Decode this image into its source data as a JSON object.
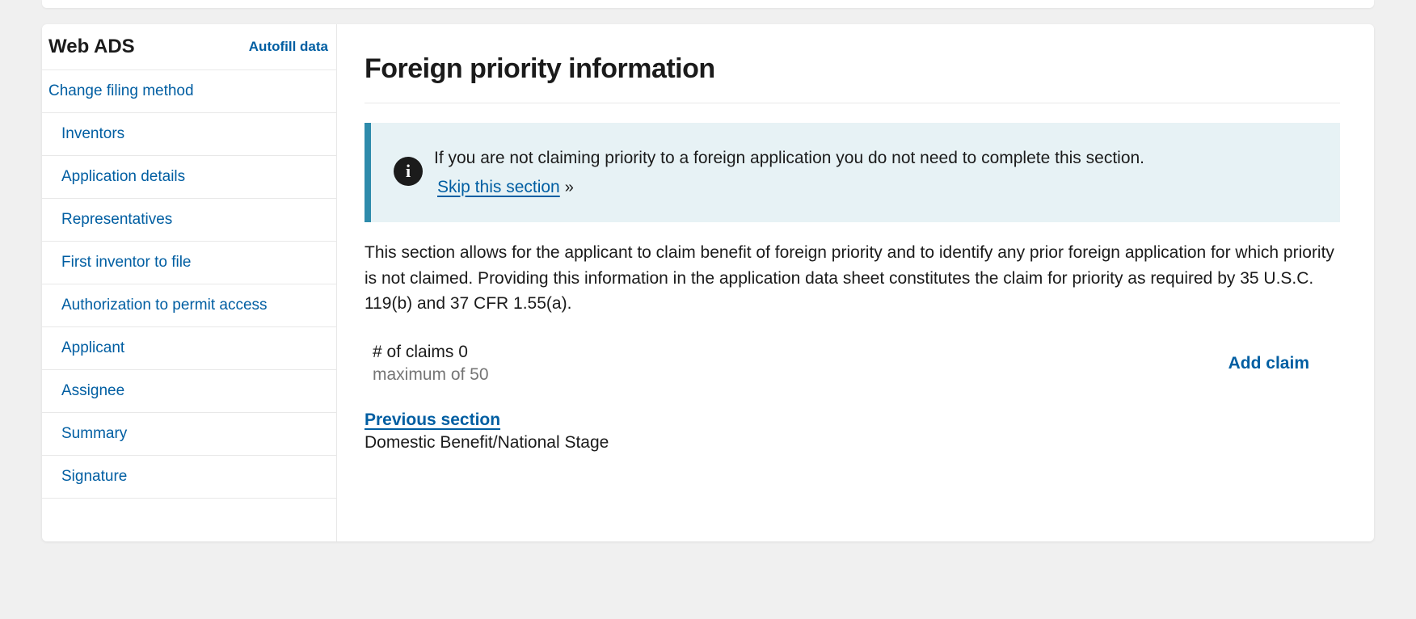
{
  "sidebar": {
    "title": "Web ADS",
    "autofill": "Autofill data",
    "top_item": "Change filing method",
    "items": [
      "Inventors",
      "Application details",
      "Representatives",
      "First inventor to file",
      "Authorization to permit access",
      "Applicant",
      "Assignee",
      "Summary",
      "Signature"
    ]
  },
  "main": {
    "heading": "Foreign priority information",
    "info_text": "If you are not claiming priority to a foreign application you do not need to complete this section.",
    "skip_label": " Skip this section ",
    "description": "This section allows for the applicant to claim benefit of foreign priority and to identify any prior foreign application for which priority is not claimed. Providing this information in the application data sheet constitutes the claim for priority as required by 35 U.S.C. 119(b) and 37 CFR 1.55(a).",
    "claims_label": "# of claims 0",
    "claims_max": "maximum of 50",
    "add_claim": "Add claim",
    "prev_link": "Previous section",
    "prev_label": "Domestic Benefit/National Stage"
  }
}
